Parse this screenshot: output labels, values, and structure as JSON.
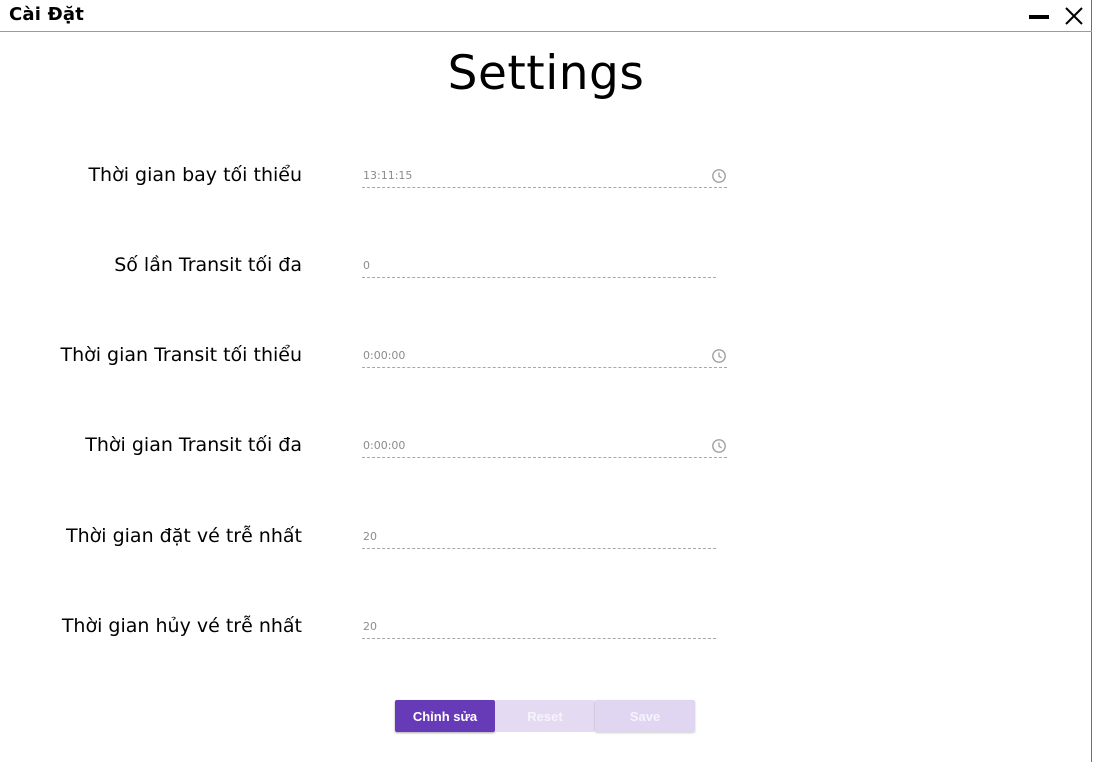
{
  "window": {
    "title": "Cài Đặt"
  },
  "page": {
    "title": "Settings"
  },
  "settings": [
    {
      "label": "Thời gian bay tối thiểu",
      "value": "13:11:15",
      "kind": "time"
    },
    {
      "label": "Số lần Transit tối đa",
      "value": "0",
      "kind": "number"
    },
    {
      "label": "Thời gian Transit tối thiểu",
      "value": "0:00:00",
      "kind": "time"
    },
    {
      "label": "Thời gian Transit tối đa",
      "value": "0:00:00",
      "kind": "time"
    },
    {
      "label": "Thời gian đặt vé trễ nhất",
      "value": "20",
      "kind": "number"
    },
    {
      "label": "Thời gian hủy vé trễ nhất",
      "value": "20",
      "kind": "number"
    }
  ],
  "actions": {
    "edit_label": "Chỉnh sửa",
    "reset_label": "Reset",
    "save_label": "Save"
  },
  "icons": {
    "minimize": "minimize-icon",
    "close": "close-icon",
    "time_picker": "clock-icon"
  },
  "colors": {
    "accent": "#673ab7",
    "disabled_button": "#e4dbf3"
  }
}
